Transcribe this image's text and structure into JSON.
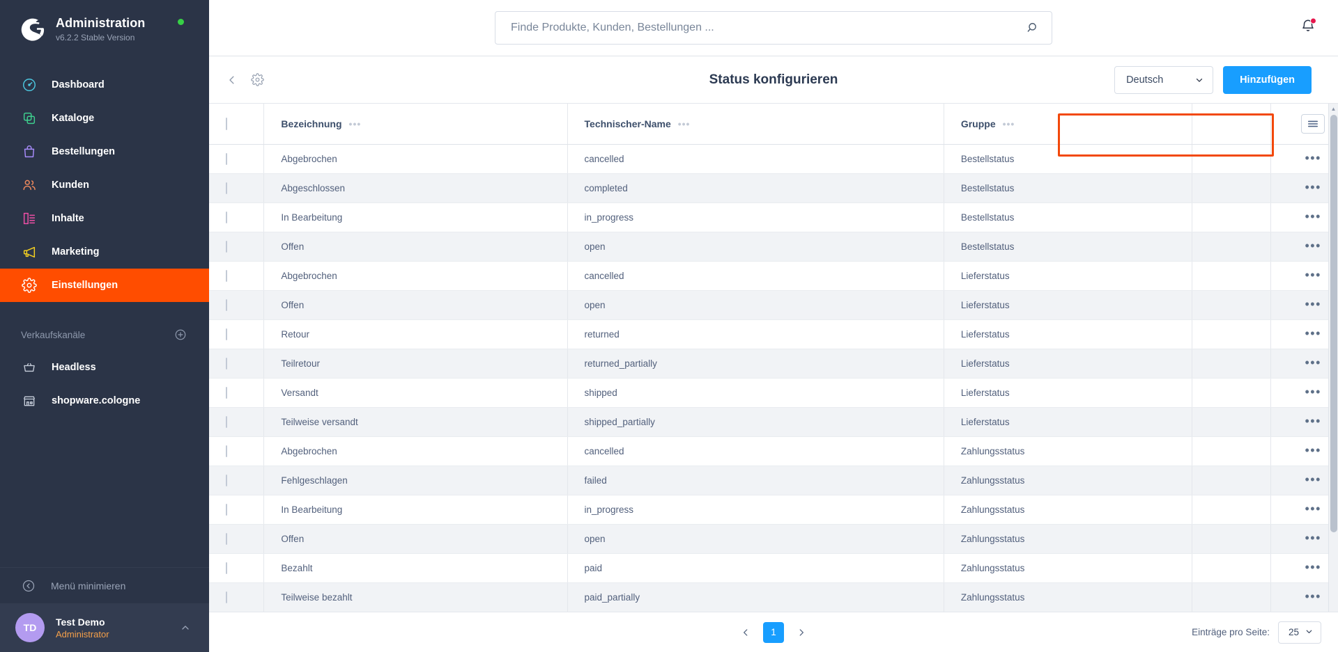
{
  "sidebar": {
    "brand": {
      "title": "Administration",
      "version": "v6.2.2 Stable Version",
      "status_color": "#37d046",
      "logo": "shopware-logo-icon"
    },
    "items": [
      {
        "label": "Dashboard",
        "icon": "dashboard-icon",
        "color": "#4cc7e0",
        "active": false
      },
      {
        "label": "Kataloge",
        "icon": "catalog-icon",
        "color": "#3ecf8e",
        "active": false
      },
      {
        "label": "Bestellungen",
        "icon": "orders-bag-icon",
        "color": "#a78bfa",
        "active": false
      },
      {
        "label": "Kunden",
        "icon": "customers-icon",
        "color": "#f08a5d",
        "active": false
      },
      {
        "label": "Inhalte",
        "icon": "content-icon",
        "color": "#ef4fa6",
        "active": false
      },
      {
        "label": "Marketing",
        "icon": "megaphone-icon",
        "color": "#f5d020",
        "active": false
      },
      {
        "label": "Einstellungen",
        "icon": "gear-icon",
        "color": "#ffffff",
        "active": true
      }
    ],
    "section": {
      "title": "Verkaufskanäle",
      "add_icon": "plus-circle-icon"
    },
    "channels": [
      {
        "label": "Headless",
        "icon": "basket-icon"
      },
      {
        "label": "shopware.cologne",
        "icon": "storefront-icon"
      }
    ],
    "minimize": {
      "label": "Menü minimieren",
      "icon": "collapse-left-icon"
    },
    "user": {
      "initials": "TD",
      "name": "Test Demo",
      "role": "Administrator",
      "avatar_color": "#b39bf0",
      "chevron": "chevron-up-icon"
    }
  },
  "topbar": {
    "search": {
      "placeholder": "Finde Produkte, Kunden, Bestellungen ...",
      "value": "",
      "icon": "search-icon"
    },
    "notifications": {
      "icon": "bell-icon",
      "has_unread": true,
      "dot_color": "#e5164c"
    }
  },
  "smartbar": {
    "back_icon": "chevron-left-icon",
    "gear_icon": "gear-icon",
    "title": "Status konfigurieren",
    "language_select": {
      "value": "Deutsch",
      "chevron": "chevron-down-icon"
    },
    "add_button": {
      "label": "Hinzufügen",
      "color": "#189eff"
    },
    "highlight_color": "#f2480b"
  },
  "table": {
    "columns": [
      {
        "key": "check",
        "label": "",
        "icon": "checkbox-icon"
      },
      {
        "key": "name",
        "label": "Bezeichnung",
        "menu": "column-menu-icon"
      },
      {
        "key": "tech",
        "label": "Technischer-Name",
        "menu": "column-menu-icon"
      },
      {
        "key": "group",
        "label": "Gruppe",
        "menu": "column-menu-icon"
      },
      {
        "key": "blank",
        "label": ""
      },
      {
        "key": "actions",
        "label": "",
        "icon": "table-settings-icon"
      }
    ],
    "rows": [
      {
        "name": "Abgebrochen",
        "tech": "cancelled",
        "group": "Bestellstatus"
      },
      {
        "name": "Abgeschlossen",
        "tech": "completed",
        "group": "Bestellstatus"
      },
      {
        "name": "In Bearbeitung",
        "tech": "in_progress",
        "group": "Bestellstatus"
      },
      {
        "name": "Offen",
        "tech": "open",
        "group": "Bestellstatus"
      },
      {
        "name": "Abgebrochen",
        "tech": "cancelled",
        "group": "Lieferstatus"
      },
      {
        "name": "Offen",
        "tech": "open",
        "group": "Lieferstatus"
      },
      {
        "name": "Retour",
        "tech": "returned",
        "group": "Lieferstatus"
      },
      {
        "name": "Teilretour",
        "tech": "returned_partially",
        "group": "Lieferstatus"
      },
      {
        "name": "Versandt",
        "tech": "shipped",
        "group": "Lieferstatus"
      },
      {
        "name": "Teilweise versandt",
        "tech": "shipped_partially",
        "group": "Lieferstatus"
      },
      {
        "name": "Abgebrochen",
        "tech": "cancelled",
        "group": "Zahlungsstatus"
      },
      {
        "name": "Fehlgeschlagen",
        "tech": "failed",
        "group": "Zahlungsstatus"
      },
      {
        "name": "In Bearbeitung",
        "tech": "in_progress",
        "group": "Zahlungsstatus"
      },
      {
        "name": "Offen",
        "tech": "open",
        "group": "Zahlungsstatus"
      },
      {
        "name": "Bezahlt",
        "tech": "paid",
        "group": "Zahlungsstatus"
      },
      {
        "name": "Teilweise bezahlt",
        "tech": "paid_partially",
        "group": "Zahlungsstatus"
      }
    ],
    "row_action_icon": "row-context-menu-icon"
  },
  "footer": {
    "prev_icon": "chevron-left-icon",
    "next_icon": "chevron-right-icon",
    "current_page": "1",
    "per_page_label": "Einträge pro Seite:",
    "per_page_value": "25",
    "per_page_chevron": "chevron-down-icon"
  }
}
